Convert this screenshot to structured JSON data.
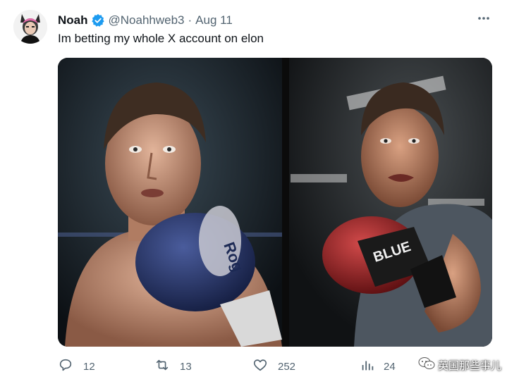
{
  "tweet": {
    "display_name": "Noah",
    "handle": "@Noahhweb3",
    "separator": "·",
    "date": "Aug 11",
    "text": "Im betting my whole X account on elon",
    "verified_icon": "verified-badge-icon",
    "more_icon": "more-icon"
  },
  "media": {
    "left_glove_text": "Rog",
    "right_glove_text": "BLUE"
  },
  "actions": {
    "replies": "12",
    "retweets": "13",
    "likes": "252",
    "views": "24"
  },
  "watermark": {
    "text": "英国那些事儿"
  },
  "colors": {
    "accent": "#1d9bf0",
    "muted": "#536471",
    "text": "#0f1419"
  }
}
